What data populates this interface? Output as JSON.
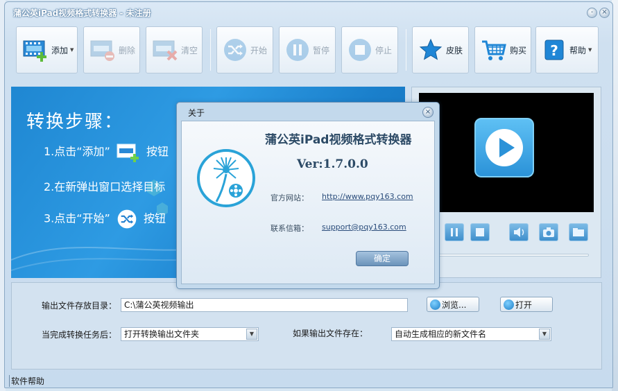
{
  "window": {
    "title": "蒲公英iPad视频格式转换器 - 未注册"
  },
  "titlebar_buttons": {
    "minimize": "-",
    "close": "×"
  },
  "toolbar": {
    "buttons": [
      {
        "label": "添加",
        "enabled": true,
        "has_dropdown": true,
        "icon": "film-add-icon"
      },
      {
        "label": "删除",
        "enabled": false,
        "icon": "film-remove-icon"
      },
      {
        "label": "清空",
        "enabled": false,
        "icon": "film-clear-icon"
      },
      {
        "label": "开始",
        "enabled": false,
        "icon": "shuffle-icon"
      },
      {
        "label": "暂停",
        "enabled": false,
        "icon": "pause-icon"
      },
      {
        "label": "停止",
        "enabled": false,
        "icon": "stop-icon"
      },
      {
        "label": "皮肤",
        "enabled": true,
        "icon": "star-icon"
      },
      {
        "label": "购买",
        "enabled": true,
        "icon": "cart-icon"
      },
      {
        "label": "帮助",
        "enabled": true,
        "has_dropdown": true,
        "icon": "help-icon"
      }
    ],
    "dropdown_arrow": "▼"
  },
  "banner": {
    "heading": "转换步骤：",
    "step1_pre": "1.点击“添加”",
    "step1_post": "按钮",
    "step2": "2.在新弹出窗口选择目标",
    "step3_pre": "3.点击“开始”",
    "step3_post": "按钮"
  },
  "settings": {
    "output_dir_label": "输出文件存放目录：",
    "output_dir_value": "C:\\蒲公英视频输出",
    "browse_label": "浏览...",
    "open_label": "打开",
    "after_complete_label": "当完成转换任务后：",
    "after_complete_value": "打开转换输出文件夹",
    "if_exists_label": "如果输出文件存在：",
    "if_exists_value": "自动生成相应的新文件名",
    "dropdown_arrow": "▼"
  },
  "status": {
    "text": "软件帮助"
  },
  "about_dialog": {
    "title": "关于",
    "close": "×",
    "app_name": "蒲公英iPad视频格式转换器",
    "version": "Ver:1.7.0.0",
    "website_label": "官方网站：",
    "website_value": "http://www.pqy163.com",
    "email_label": "联系信箱：",
    "email_value": "support@pqy163.com",
    "ok_label": "确定"
  },
  "colors": {
    "accent": "#2e9be3",
    "window_bg": "#cfe0f0",
    "video_bg": "#000000",
    "play_button": "#3ba6e6"
  }
}
